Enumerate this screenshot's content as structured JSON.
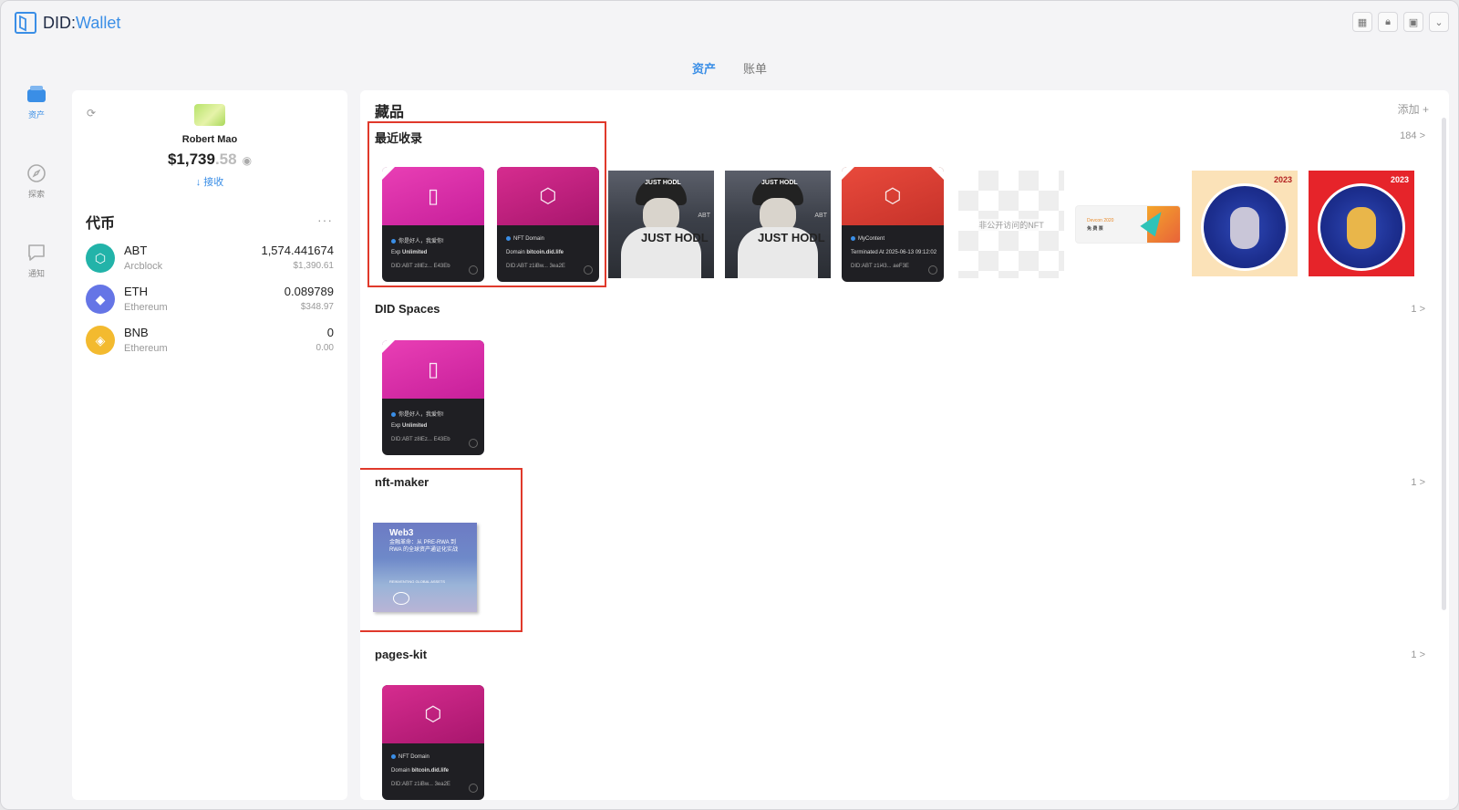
{
  "app": {
    "logo_prefix": "DID:",
    "logo_suffix": "Wallet"
  },
  "window_controls": [
    "grid-icon",
    "lock-icon",
    "panel-icon",
    "chevron-down-icon"
  ],
  "tabs": [
    {
      "label": "资产",
      "active": true
    },
    {
      "label": "账单",
      "active": false
    }
  ],
  "nav": [
    {
      "label": "资产",
      "icon": "wallet-icon",
      "active": true
    },
    {
      "label": "探索",
      "icon": "compass-icon",
      "active": false
    },
    {
      "label": "通知",
      "icon": "message-icon",
      "active": false
    }
  ],
  "profile": {
    "name": "Robert Mao",
    "balance_int": "$1,739",
    "balance_dec": ".58",
    "receive_label": "接收"
  },
  "tokens": {
    "title": "代币",
    "items": [
      {
        "symbol": "ABT",
        "chain": "Arcblock",
        "amount": "1,574.441674",
        "usd": "$1,390.61",
        "color": "#22b3a9"
      },
      {
        "symbol": "ETH",
        "chain": "Ethereum",
        "amount": "0.089789",
        "usd": "$348.97",
        "color": "#6575e6"
      },
      {
        "symbol": "BNB",
        "chain": "Ethereum",
        "amount": "0",
        "usd": "0.00",
        "color": "#f3ba2f"
      }
    ]
  },
  "collectibles": {
    "title": "藏品",
    "add_label": "添加 +",
    "sections": [
      {
        "title": "最近收录",
        "count": "184 >"
      },
      {
        "title": "DID Spaces",
        "count": "1 >"
      },
      {
        "title": "nft-maker",
        "count": "1 >"
      },
      {
        "title": "pages-kit",
        "count": "1 >"
      }
    ],
    "cards": {
      "space_l1": "你是好人，我爱你!",
      "space_l2_key": "Exp",
      "space_l2_val": "Unlimited",
      "space_l3": "DID:ABT z8lEz... E43Eb",
      "domain_l1": "NFT Domain",
      "domain_l2_key": "Domain",
      "domain_l2_val": "bitcoin.did.life",
      "domain_l3": "DID:ABT z1iBw... 3ea2E",
      "content_l1": "MyContent",
      "content_l2": "Terminated At  2025-06-13 09:12:02",
      "content_l3": "DID:ABT z1i43... aeF3E",
      "ape_cap": "JUST HODL",
      "ape_hood": "JUST HODL",
      "ape_tag": "ABT",
      "private_label": "非公开访问的NFT",
      "ticket_l1": "Devcon 2020",
      "ticket_l2": "免 费 票",
      "zodiac_year": "2023",
      "book_title": "Web3",
      "book_sub": "金融革命：从 PRE-RWA 到 RWA 的全球资产通证化实战",
      "book_foot": "REINVENTING GLOBAL ASSETS"
    }
  }
}
